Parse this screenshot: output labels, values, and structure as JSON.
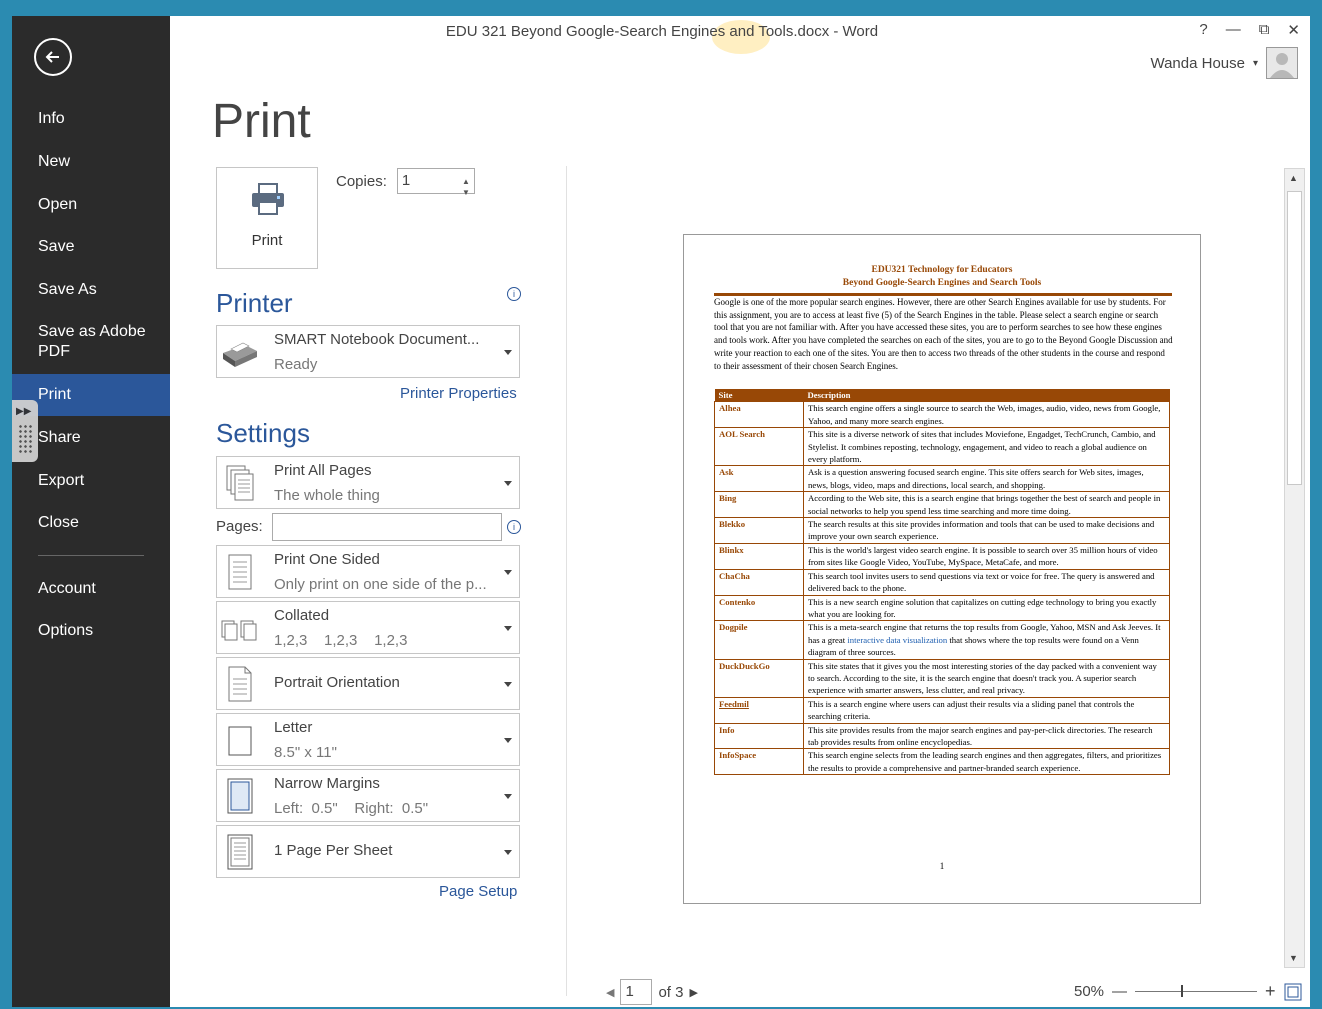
{
  "window": {
    "title": "EDU 321 Beyond Google-Search Engines and Tools.docx - Word",
    "controls": {
      "help": "?",
      "minimize": "—",
      "restore": "⧉",
      "close": "✕"
    },
    "user": "Wanda House",
    "user_caret": "▾"
  },
  "backstage": {
    "items": [
      {
        "label": "Info"
      },
      {
        "label": "New"
      },
      {
        "label": "Open"
      },
      {
        "label": "Save"
      },
      {
        "label": "Save As"
      },
      {
        "label": "Save as Adobe PDF"
      },
      {
        "label": "Print"
      },
      {
        "label": "Share"
      },
      {
        "label": "Export"
      },
      {
        "label": "Close"
      },
      {
        "label": "Account"
      },
      {
        "label": "Options"
      }
    ],
    "selected": "Print"
  },
  "print": {
    "heading": "Print",
    "button_label": "Print",
    "copies_label": "Copies:",
    "copies_value": "1",
    "printer_heading": "Printer",
    "printer_name": "SMART Notebook Document...",
    "printer_status": "Ready",
    "printer_properties": "Printer Properties",
    "settings_heading": "Settings",
    "pages_label": "Pages:",
    "pages_value": "",
    "page_setup": "Page Setup",
    "settings": [
      {
        "title": "Print All Pages",
        "subtitle": "The whole thing"
      },
      {
        "title": "Print One Sided",
        "subtitle": "Only print on one side of the p..."
      },
      {
        "title": "Collated",
        "subtitle": "1,2,3    1,2,3    1,2,3"
      },
      {
        "title": "Portrait Orientation",
        "subtitle": ""
      },
      {
        "title": "Letter",
        "subtitle": "8.5\" x 11\""
      },
      {
        "title": "Narrow Margins",
        "subtitle": "Left:  0.5\"    Right:  0.5\""
      },
      {
        "title": "1 Page Per Sheet",
        "subtitle": ""
      }
    ]
  },
  "preview": {
    "doc_title_1": "EDU321 Technology for Educators",
    "doc_title_2": "Beyond Google-Search Engines and Search Tools",
    "intro": "Google is one of the more popular search engines. However, there are other Search Engines available for use by students. For this assignment, you are to access at least five (5) of the Search Engines in the table. Please select a search engine or search tool that you are not familiar with. After you have accessed these sites, you are to perform searches to see how these engines and tools work. After you have completed the searches on each of the sites, you are to go to the Beyond Google Discussion and write your reaction to each one of the sites. You are then to access two threads of the other students in the course and respond to their assessment of their chosen Search Engines.",
    "table_headers": [
      "Site",
      "Description"
    ],
    "rows": [
      {
        "site": "Alhea",
        "desc": "This search engine offers a single source to search the Web, images, audio, video, news from Google, Yahoo, and many more search engines."
      },
      {
        "site": "AOL Search",
        "desc": "This site is a diverse network of sites that includes Moviefone, Engadget, TechCrunch, Cambio, and Stylelist. It combines reposting, technology, engagement, and video to reach a global audience on every platform."
      },
      {
        "site": "Ask",
        "desc": "Ask is a question answering focused search engine. This site offers search for Web sites, images, news, blogs, video, maps and directions, local search, and shopping."
      },
      {
        "site": "Bing",
        "desc": "According to the Web site, this is a search engine that brings together the best of search and people in social networks to help you spend less time searching and more time doing."
      },
      {
        "site": "Blekko",
        "desc": "The search results at this site provides information and tools that can be used to make decisions and improve your own search experience."
      },
      {
        "site": "Blinkx",
        "desc": "This is the world's largest video search engine. It is possible to search over 35 million hours of video from sites like Google Video, YouTube, MySpace, MetaCafe, and more."
      },
      {
        "site": "ChaCha",
        "desc": "This search tool invites users to send questions via text or voice for free. The query is answered and delivered back to the phone."
      },
      {
        "site": "Contenko",
        "desc": "This is a new search engine solution that capitalizes on cutting edge technology to bring you exactly what you are looking for."
      },
      {
        "site": "Dogpile",
        "desc_pre": "This is a meta-search engine that returns the top results from Google, Yahoo, MSN and Ask Jeeves. It has a great ",
        "desc_link": "interactive data visualization",
        "desc_post": " that shows where the top results were found on a Venn diagram of three sources."
      },
      {
        "site": "DuckDuckGo",
        "desc": "This site states that it gives you the most interesting stories of the day packed with a convenient way to search. According to the site, it is the search engine that doesn't track you. A superior search experience with smarter answers, less clutter, and real privacy."
      },
      {
        "site": "Feedmil",
        "desc": "This is a search engine where users can adjust their results via a sliding panel that controls the searching criteria."
      },
      {
        "site": "Info",
        "desc": "This site provides results from the major search engines and pay-per-click directories. The research tab provides results from online encyclopedias."
      },
      {
        "site": "InfoSpace",
        "desc": "This search engine selects from the leading search engines and then aggregates, filters, and prioritizes the results to provide a comprehensive and partner-branded search experience."
      }
    ],
    "page_number": "1"
  },
  "navigator": {
    "current_page": "1",
    "of_pages": "of 3"
  },
  "zoom": {
    "level": "50%",
    "minus": "—",
    "plus": "+"
  },
  "colors": {
    "accent": "#2b579a",
    "backstage_bg": "#2b2b2b",
    "doc_brown": "#984806",
    "frame": "#2b8bb1"
  }
}
